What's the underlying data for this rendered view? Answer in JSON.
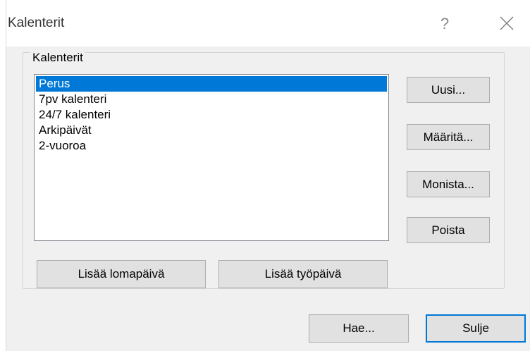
{
  "window": {
    "title": "Kalenterit",
    "help_symbol": "?",
    "close_icon": "close-icon"
  },
  "group": {
    "label": "Kalenterit"
  },
  "calendar_list": {
    "items": [
      "Perus",
      "7pv kalenteri",
      "24/7 kalenteri",
      "Arkipäivät",
      "2-vuoroa"
    ],
    "selected_index": 0,
    "selection_color": "#0078d7"
  },
  "side_buttons": {
    "new_label": "Uusi...",
    "define_label": "Määritä...",
    "duplicate_label": "Monista...",
    "delete_label": "Poista"
  },
  "bottom_buttons": {
    "add_holiday_label": "Lisää lomapäivä",
    "add_workday_label": "Lisää työpäivä"
  },
  "dialog_buttons": {
    "fetch_label": "Hae...",
    "close_label": "Sulje"
  }
}
